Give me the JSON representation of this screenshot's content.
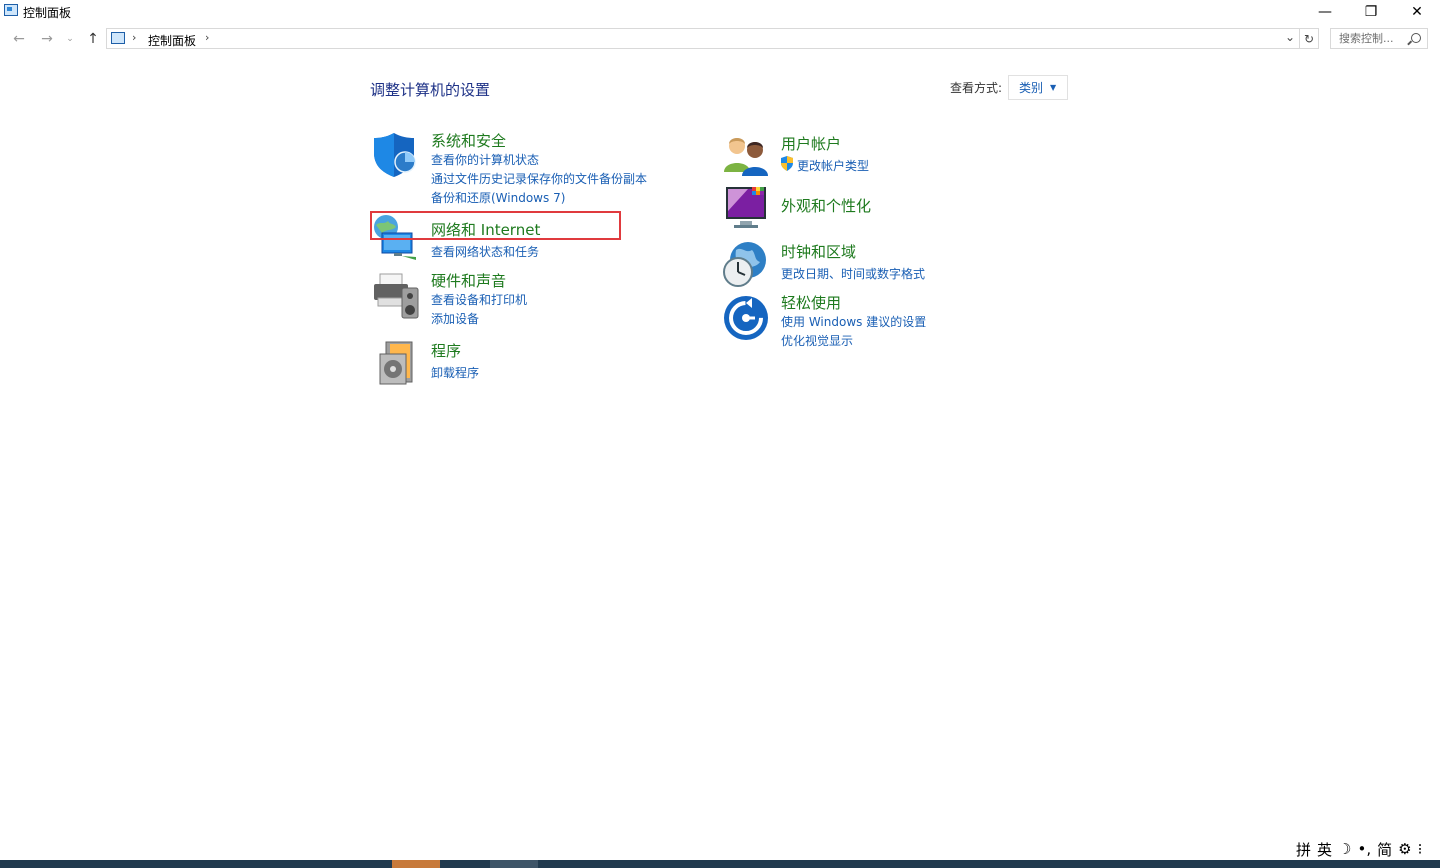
{
  "window": {
    "title": "控制面板",
    "buttons": {
      "minimize": "—",
      "restore": "❐",
      "close": "✕"
    }
  },
  "nav": {
    "back_icon": "←",
    "forward_icon": "→",
    "recent_icon": "⌄",
    "up_icon": "↑",
    "breadcrumb_sep": "›",
    "breadcrumb": "控制面板",
    "dropdown_icon": "⌄",
    "refresh_icon": "↻",
    "search_placeholder": "搜索控制..."
  },
  "main": {
    "heading": "调整计算机的设置",
    "view_by_label": "查看方式:",
    "view_by_value": "类别",
    "view_by_caret": "▼"
  },
  "categories": {
    "system_security": {
      "title": "系统和安全",
      "links": [
        "查看你的计算机状态",
        "通过文件历史记录保存你的文件备份副本",
        "备份和还原(Windows 7)"
      ]
    },
    "network": {
      "title": "网络和 Internet",
      "links": [
        "查看网络状态和任务"
      ]
    },
    "hardware": {
      "title": "硬件和声音",
      "links": [
        "查看设备和打印机",
        "添加设备"
      ]
    },
    "programs": {
      "title": "程序",
      "links": [
        "卸载程序"
      ]
    },
    "user_accounts": {
      "title": "用户帐户",
      "links": [
        "更改帐户类型"
      ]
    },
    "appearance": {
      "title": "外观和个性化",
      "links": []
    },
    "clock_region": {
      "title": "时钟和区域",
      "links": [
        "更改日期、时间或数字格式"
      ]
    },
    "ease_of_access": {
      "title": "轻松使用",
      "links": [
        "使用 Windows 建议的设置",
        "优化视觉显示"
      ]
    }
  },
  "ime": {
    "items": [
      "拼",
      "英",
      "☽",
      "•,",
      "简",
      "⚙",
      "⁝"
    ]
  },
  "colors": {
    "category_title": "#1e7a1e",
    "link": "#1a5fb4",
    "heading": "#1e3287",
    "highlight": "#e03a3e",
    "taskbar": "#213a4e"
  }
}
